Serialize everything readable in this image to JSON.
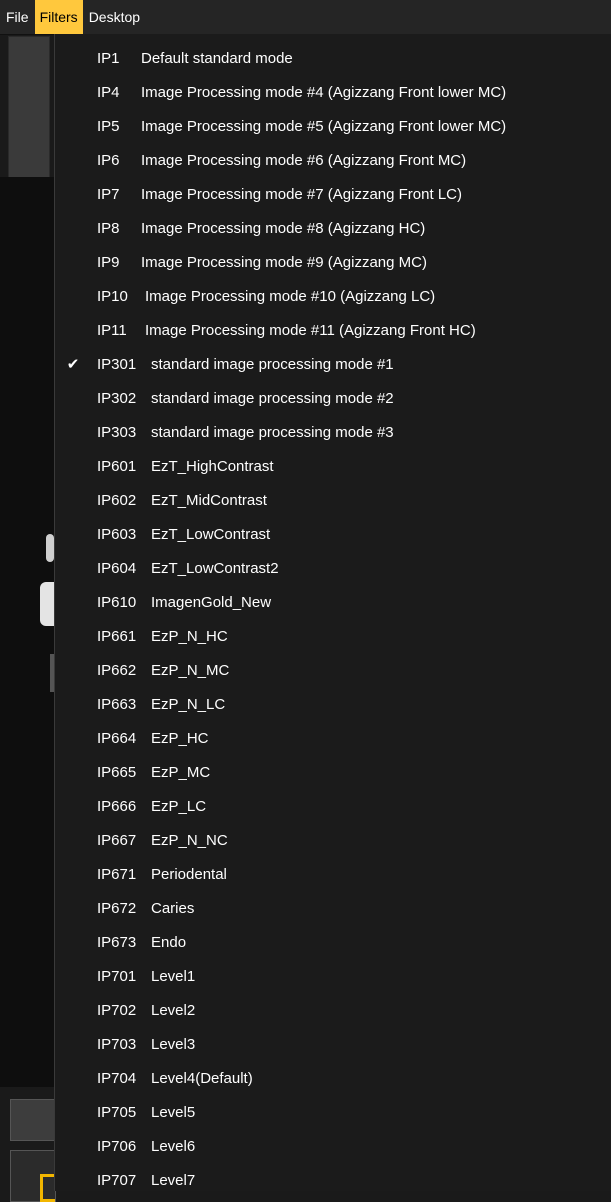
{
  "menubar": [
    {
      "label": "File",
      "active": false
    },
    {
      "label": "Filters",
      "active": true
    },
    {
      "label": "Desktop",
      "active": false
    }
  ],
  "filters_menu": [
    {
      "code": "IP1",
      "label": "Default standard mode",
      "checked": false
    },
    {
      "code": "IP4",
      "label": "Image Processing mode #4 (Agizzang Front lower MC)",
      "checked": false
    },
    {
      "code": "IP5",
      "label": "Image Processing mode #5 (Agizzang Front lower MC)",
      "checked": false
    },
    {
      "code": "IP6",
      "label": "Image Processing mode #6 (Agizzang Front MC)",
      "checked": false
    },
    {
      "code": "IP7",
      "label": "Image Processing mode #7 (Agizzang Front LC)",
      "checked": false
    },
    {
      "code": "IP8",
      "label": "Image Processing mode #8 (Agizzang HC)",
      "checked": false
    },
    {
      "code": "IP9",
      "label": "Image Processing mode #9 (Agizzang MC)",
      "checked": false
    },
    {
      "code": "IP10",
      "label": "Image Processing mode #10 (Agizzang LC)",
      "checked": false
    },
    {
      "code": "IP11",
      "label": "Image Processing mode #11 (Agizzang Front HC)",
      "checked": false
    },
    {
      "code": "IP301",
      "label": "standard image processing mode #1",
      "checked": true
    },
    {
      "code": "IP302",
      "label": "standard image processing mode #2",
      "checked": false
    },
    {
      "code": "IP303",
      "label": "standard image processing mode #3",
      "checked": false
    },
    {
      "code": "IP601",
      "label": "EzT_HighContrast",
      "checked": false
    },
    {
      "code": "IP602",
      "label": "EzT_MidContrast",
      "checked": false
    },
    {
      "code": "IP603",
      "label": "EzT_LowContrast",
      "checked": false
    },
    {
      "code": "IP604",
      "label": "EzT_LowContrast2",
      "checked": false
    },
    {
      "code": "IP610",
      "label": "ImagenGold_New",
      "checked": false
    },
    {
      "code": "IP661",
      "label": "EzP_N_HC",
      "checked": false
    },
    {
      "code": "IP662",
      "label": "EzP_N_MC",
      "checked": false
    },
    {
      "code": "IP663",
      "label": "EzP_N_LC",
      "checked": false
    },
    {
      "code": "IP664",
      "label": "EzP_HC",
      "checked": false
    },
    {
      "code": "IP665",
      "label": "EzP_MC",
      "checked": false
    },
    {
      "code": "IP666",
      "label": "EzP_LC",
      "checked": false
    },
    {
      "code": "IP667",
      "label": "EzP_N_NC",
      "checked": false
    },
    {
      "code": "IP671",
      "label": "Periodental",
      "checked": false
    },
    {
      "code": "IP672",
      "label": "Caries",
      "checked": false
    },
    {
      "code": "IP673",
      "label": "Endo",
      "checked": false
    },
    {
      "code": "IP701",
      "label": "Level1",
      "checked": false
    },
    {
      "code": "IP702",
      "label": "Level2",
      "checked": false
    },
    {
      "code": "IP703",
      "label": "Level3",
      "checked": false
    },
    {
      "code": "IP704",
      "label": "Level4(Default)",
      "checked": false
    },
    {
      "code": "IP705",
      "label": "Level5",
      "checked": false
    },
    {
      "code": "IP706",
      "label": "Level6",
      "checked": false
    },
    {
      "code": "IP707",
      "label": "Level7",
      "checked": false
    }
  ],
  "check_glyph": "✔",
  "colors": {
    "menu_active_bg": "#ffc83d",
    "menu_bg": "#1b1b1b",
    "text": "#ffffff"
  }
}
